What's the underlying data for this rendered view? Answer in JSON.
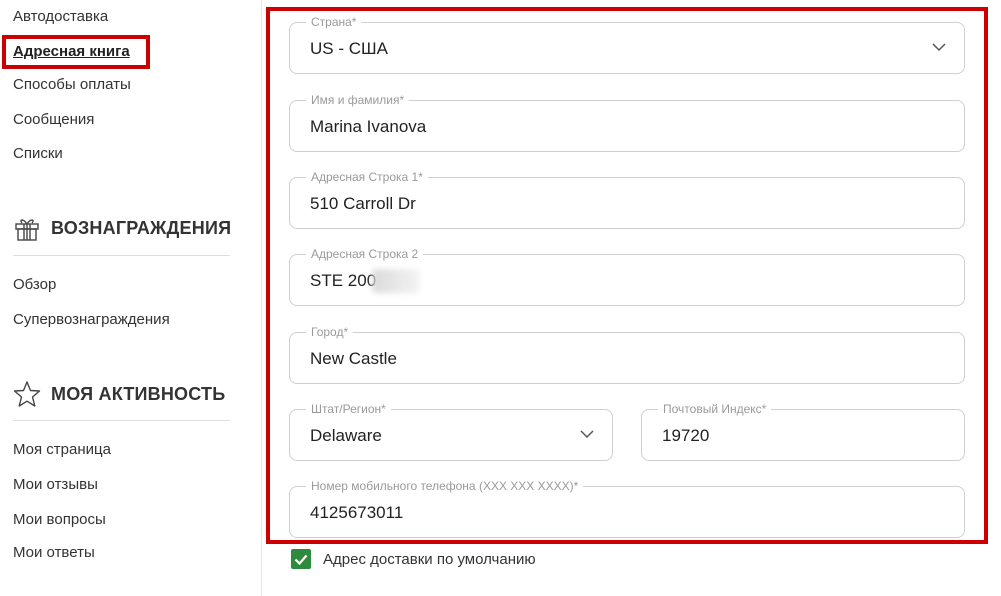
{
  "sidebar": {
    "account_items": [
      {
        "label": "Автодоставка"
      },
      {
        "label": "Адресная книга"
      },
      {
        "label": "Способы оплаты"
      },
      {
        "label": "Сообщения"
      },
      {
        "label": "Списки"
      }
    ],
    "rewards": {
      "title": "ВОЗНАГРАЖДЕНИЯ",
      "icon": "gift-icon",
      "items": [
        {
          "label": "Обзор"
        },
        {
          "label": "Супервознаграждения"
        }
      ]
    },
    "activity": {
      "title": "МОЯ АКТИВНОСТЬ",
      "icon": "star-icon",
      "items": [
        {
          "label": "Моя страница"
        },
        {
          "label": "Мои отзывы"
        },
        {
          "label": "Мои вопросы"
        },
        {
          "label": "Мои ответы"
        }
      ]
    }
  },
  "form": {
    "country": {
      "label": "Страна*",
      "value": "US - США"
    },
    "full_name": {
      "label": "Имя и фамилия*",
      "value": "Marina Ivanova"
    },
    "address1": {
      "label": "Адресная Строка 1*",
      "value": "510 Carroll Dr"
    },
    "address2": {
      "label": "Адресная Строка 2",
      "value": "STE 200"
    },
    "city": {
      "label": "Город*",
      "value": "New Castle"
    },
    "state": {
      "label": "Штат/Регион*",
      "value": "Delaware"
    },
    "zip": {
      "label": "Почтовый Индекс*",
      "value": "19720"
    },
    "phone": {
      "label": "Номер мобильного телефона (XXX XXX XXXX)*",
      "value": "4125673011"
    },
    "default_address": {
      "label": "Адрес доставки по умолчанию",
      "checked": true
    }
  },
  "colors": {
    "highlight": "#cc0000",
    "checkbox": "#2e8b3d",
    "label": "#9a9a9a",
    "border": "#cfcfcf"
  }
}
